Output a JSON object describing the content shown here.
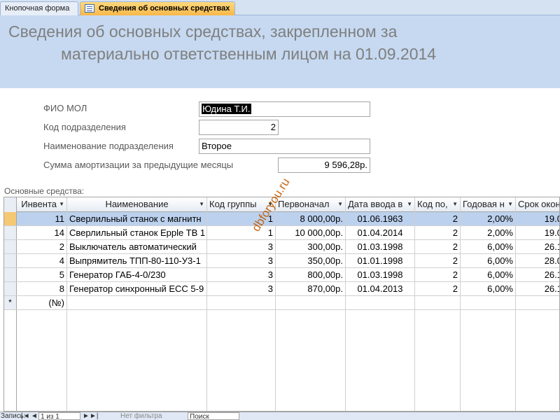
{
  "tabs": [
    {
      "label": "Кнопочная форма",
      "active": false
    },
    {
      "label": "Сведения об основных средствах",
      "active": true
    }
  ],
  "header": {
    "title_line1": "Сведения об основных средствах, закрепленном за",
    "title_line2": "материально ответственным лицом на 01.09.2014"
  },
  "form": {
    "fio_label": "ФИО МОЛ",
    "fio_value": "Юдина Т.И.",
    "dept_code_label": "Код подразделения",
    "dept_code_value": "2",
    "dept_name_label": "Наименование подразделения",
    "dept_name_value": "Второе",
    "amort_label": "Сумма амортизации за предыдущие месяцы",
    "amort_value": "9 596,28р."
  },
  "subform_label": "Основные средства:",
  "grid": {
    "columns": [
      "Инвента",
      "Наименование",
      "Код группы",
      "Первоначал",
      "Дата ввода в",
      "Код по,",
      "Годовая н",
      "Срок окон"
    ],
    "rows": [
      [
        "11",
        "Сверлильный станок с магнитн",
        "1",
        "8 000,00р.",
        "01.06.1963",
        "2",
        "2,00%",
        "19.0"
      ],
      [
        "14",
        "Сверлильный станок Epple TB 1",
        "1",
        "10 000,00р.",
        "01.04.2014",
        "2",
        "2,00%",
        "19.0"
      ],
      [
        "2",
        "Выключатель автоматический",
        "3",
        "300,00р.",
        "01.03.1998",
        "2",
        "6,00%",
        "26.1"
      ],
      [
        "4",
        "Выпрямитель ТПП-80-110-У3-1",
        "3",
        "350,00р.",
        "01.01.1998",
        "2",
        "6,00%",
        "28.0"
      ],
      [
        "5",
        "Генератор ГАБ-4-0/230",
        "3",
        "800,00р.",
        "01.03.1998",
        "2",
        "6,00%",
        "26.1"
      ],
      [
        "8",
        "Генератор синхронный ЕСС 5-9",
        "3",
        "870,00р.",
        "01.04.2013",
        "2",
        "6,00%",
        "26.1"
      ]
    ],
    "new_row_marker": "*",
    "new_row_placeholder": "(№)"
  },
  "nav": {
    "record_label": "Запись:",
    "first": "|◄",
    "prev": "◄",
    "position": "1 из 1",
    "next": "►",
    "last": "►|",
    "filter_label": "Нет фильтра",
    "search_label": "Поиск"
  },
  "watermark": "dbforyou.ru",
  "colors": {
    "header_band": "#c6d9f1",
    "active_tab": "#f8b84a",
    "selected_row": "#bcd1ee",
    "watermark": "#c25a00"
  }
}
